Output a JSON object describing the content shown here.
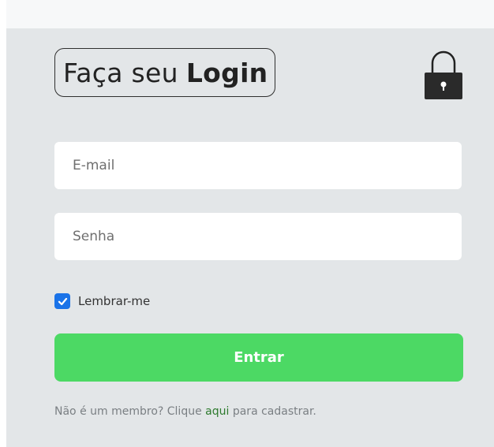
{
  "login": {
    "title_regular": "Faça seu",
    "title_bold": "Login",
    "email": {
      "placeholder": "E-mail",
      "value": ""
    },
    "password": {
      "placeholder": "Senha",
      "value": ""
    },
    "remember": {
      "label": "Lembrar-me",
      "checked": true
    },
    "submit_label": "Entrar",
    "signup": {
      "prefix": "Não é um membro? Clique",
      "link_text": "aqui",
      "suffix": "para cadastrar."
    }
  },
  "icons": {
    "lock": "lock-icon",
    "check": "check-icon"
  },
  "colors": {
    "panel_background": "#e3e6e8",
    "button_green": "#4cd964",
    "checkbox_blue": "#1a73e8",
    "link_green": "#2d7a2d"
  }
}
